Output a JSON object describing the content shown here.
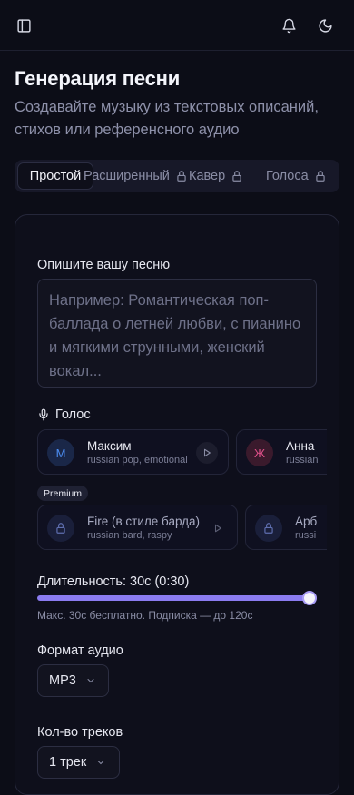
{
  "header": {
    "sidebar_toggle_icon": "sidebar-toggle-icon",
    "notifications_icon": "bell-icon",
    "theme_icon": "moon-icon"
  },
  "page": {
    "title": "Генерация песни",
    "subtitle": "Создавайте музыку из текстовых описаний, стихов или референсного аудио"
  },
  "tabs": [
    {
      "label": "Простой",
      "active": true,
      "locked": false
    },
    {
      "label": "Расширенный",
      "active": false,
      "locked": true
    },
    {
      "label": "Кавер",
      "active": false,
      "locked": true
    },
    {
      "label": "Голоса",
      "active": false,
      "locked": true
    }
  ],
  "form": {
    "description_label": "Опишите вашу песню",
    "description_placeholder": "Например: Романтическая поп-баллада о летней любви, с пианино и мягкими струнными, женский вокал...",
    "voice_label": "Голос",
    "voices": [
      {
        "initial": "М",
        "name": "Максим",
        "desc": "russian pop, emotional",
        "color": "#4d8ff5"
      },
      {
        "initial": "Ж",
        "name": "Анна",
        "desc": "russian",
        "color": "#e0508a"
      }
    ],
    "premium_badge": "Premium",
    "premium_voices": [
      {
        "name": "Fire (в стиле барда)",
        "desc": "russian bard, raspy"
      },
      {
        "name": "Арб",
        "desc": "russi"
      }
    ],
    "duration_label": "Длительность: 30с (0:30)",
    "duration_fraction": 1.0,
    "duration_hint": "Макс. 30с бесплатно. Подписка — до 120с",
    "format_label": "Формат аудио",
    "format_value": "MP3",
    "tracks_label": "Кол-во треков",
    "tracks_value": "1 трек"
  },
  "colors": {
    "background": "#0c0d17",
    "accent": "#8b7cf0",
    "card_border": "#25273a"
  }
}
